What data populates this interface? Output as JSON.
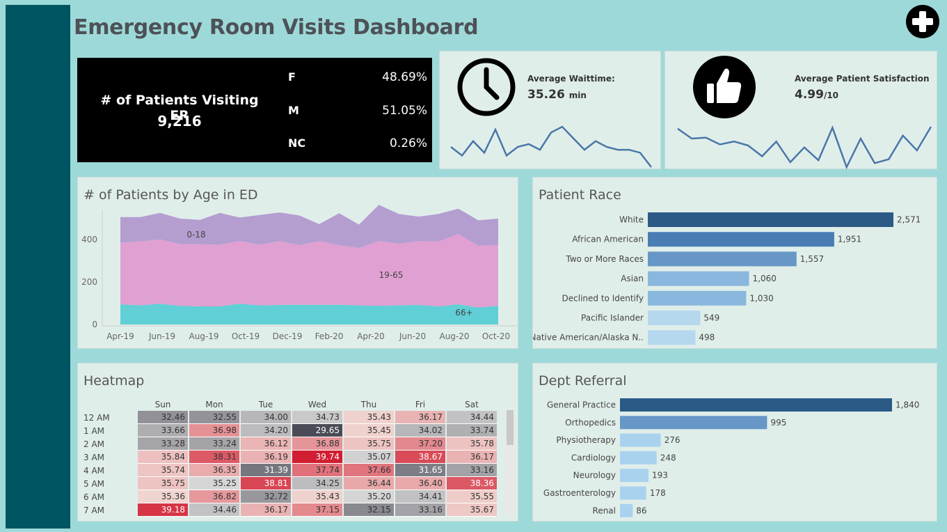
{
  "header": {
    "title": "Emergency Room Visits Dashboard",
    "logo_icon": "medical-cross-icon"
  },
  "patients_kpi": {
    "label": "# of Patients Visiting ER",
    "value": "9,216",
    "gender": [
      {
        "key": "F",
        "value": "48.69%"
      },
      {
        "key": "M",
        "value": "51.05%"
      },
      {
        "key": "NC",
        "value": "0.26%"
      }
    ]
  },
  "waittime_kpi": {
    "icon": "clock-icon",
    "label": "Average Waittime:",
    "value": "35.26",
    "unit": "min",
    "trend": [
      36,
      33,
      38,
      34,
      42,
      33,
      36,
      37,
      35,
      41,
      43,
      39,
      35,
      38,
      36,
      35,
      35,
      34,
      29
    ]
  },
  "satisfaction_kpi": {
    "icon": "thumbs-up-icon",
    "label": "Average Patient Satisfaction",
    "value": "4.99",
    "unit": "/10",
    "trend": [
      6,
      5,
      5.1,
      4.4,
      4.7,
      4.3,
      3.2,
      4.7,
      2.6,
      4.1,
      2.8,
      6.1,
      2.1,
      5,
      2.5,
      2.9,
      5.3,
      3.8,
      6.2
    ]
  },
  "chart_data": [
    {
      "type": "area",
      "title": "# of Patients by Age in ED",
      "x_ticks": [
        "Apr-19",
        "Jun-19",
        "Aug-19",
        "Oct-19",
        "Dec-19",
        "Feb-20",
        "Apr-20",
        "Jun-20",
        "Aug-20",
        "Oct-20"
      ],
      "y_ticks": [
        "0",
        "200",
        "400"
      ],
      "ylim": [
        0,
        560
      ],
      "series": [
        {
          "name": "66+",
          "color": "#60cfd6",
          "values": [
            95,
            90,
            98,
            88,
            85,
            85,
            98,
            90,
            92,
            93,
            92,
            93,
            90,
            88,
            90,
            92,
            85,
            95,
            80,
            88
          ]
        },
        {
          "name": "19-65",
          "color": "#e0a0d2",
          "values": [
            290,
            300,
            302,
            290,
            292,
            290,
            295,
            285,
            300,
            280,
            300,
            280,
            270,
            305,
            290,
            300,
            305,
            330,
            290,
            285
          ]
        },
        {
          "name": "0-18",
          "color": "#b49ed0",
          "values": [
            120,
            115,
            125,
            120,
            115,
            150,
            110,
            140,
            135,
            140,
            80,
            150,
            110,
            170,
            140,
            115,
            130,
            120,
            120,
            125
          ]
        }
      ]
    },
    {
      "type": "bar",
      "title": "Patient Race",
      "categories": [
        "White",
        "African American",
        "Two or More Races",
        "Asian",
        "Declined to Identify",
        "Pacific Islander",
        "Native American/Alaska N.."
      ],
      "values": [
        2571,
        1951,
        1557,
        1060,
        1030,
        549,
        498
      ],
      "labels": [
        "2,571",
        "1,951",
        "1,557",
        "1,060",
        "1,030",
        "549",
        "498"
      ],
      "colors": [
        "#2b5a87",
        "#4a7db3",
        "#6697c6",
        "#8ab7dd",
        "#8ab7dd",
        "#b5d8ee",
        "#b5d8ee"
      ]
    },
    {
      "type": "bar",
      "title": "Dept Referral",
      "categories": [
        "General Practice",
        "Orthopedics",
        "Physiotherapy",
        "Cardiology",
        "Neurology",
        "Gastroenterology",
        "Renal"
      ],
      "values": [
        1840,
        995,
        276,
        248,
        193,
        178,
        86
      ],
      "labels": [
        "1,840",
        "995",
        "276",
        "248",
        "193",
        "178",
        "86"
      ],
      "colors": [
        "#2b5a87",
        "#6697c6",
        "#a9d2ef",
        "#a9d2ef",
        "#a9d2ef",
        "#a9d2ef",
        "#a9d2ef"
      ]
    },
    {
      "type": "heatmap",
      "title": "Heatmap",
      "columns": [
        "Sun",
        "Mon",
        "Tue",
        "Wed",
        "Thu",
        "Fri",
        "Sat"
      ],
      "rows": [
        {
          "label": "12 AM",
          "values": [
            "32.46",
            "32.55",
            "34.00",
            "34.73",
            "35.43",
            "36.17",
            "34.44"
          ]
        },
        {
          "label": "1 AM",
          "values": [
            "33.66",
            "36.98",
            "34.20",
            "29.65",
            "35.45",
            "34.02",
            "33.74"
          ]
        },
        {
          "label": "2 AM",
          "values": [
            "33.28",
            "33.24",
            "36.12",
            "36.88",
            "35.75",
            "37.20",
            "35.78"
          ]
        },
        {
          "label": "3 AM",
          "values": [
            "35.84",
            "38.31",
            "36.19",
            "39.74",
            "35.07",
            "38.67",
            "36.17"
          ]
        },
        {
          "label": "4 AM",
          "values": [
            "35.74",
            "36.35",
            "31.39",
            "37.74",
            "37.66",
            "31.65",
            "33.16"
          ]
        },
        {
          "label": "5 AM",
          "values": [
            "35.75",
            "35.25",
            "38.81",
            "34.25",
            "36.44",
            "36.40",
            "38.36"
          ]
        },
        {
          "label": "6 AM",
          "values": [
            "35.36",
            "36.82",
            "32.72",
            "35.43",
            "35.20",
            "34.41",
            "35.55"
          ]
        },
        {
          "label": "7 AM",
          "values": [
            "39.18",
            "34.46",
            "36.17",
            "37.15",
            "32.15",
            "33.16",
            "35.67"
          ]
        }
      ]
    }
  ]
}
